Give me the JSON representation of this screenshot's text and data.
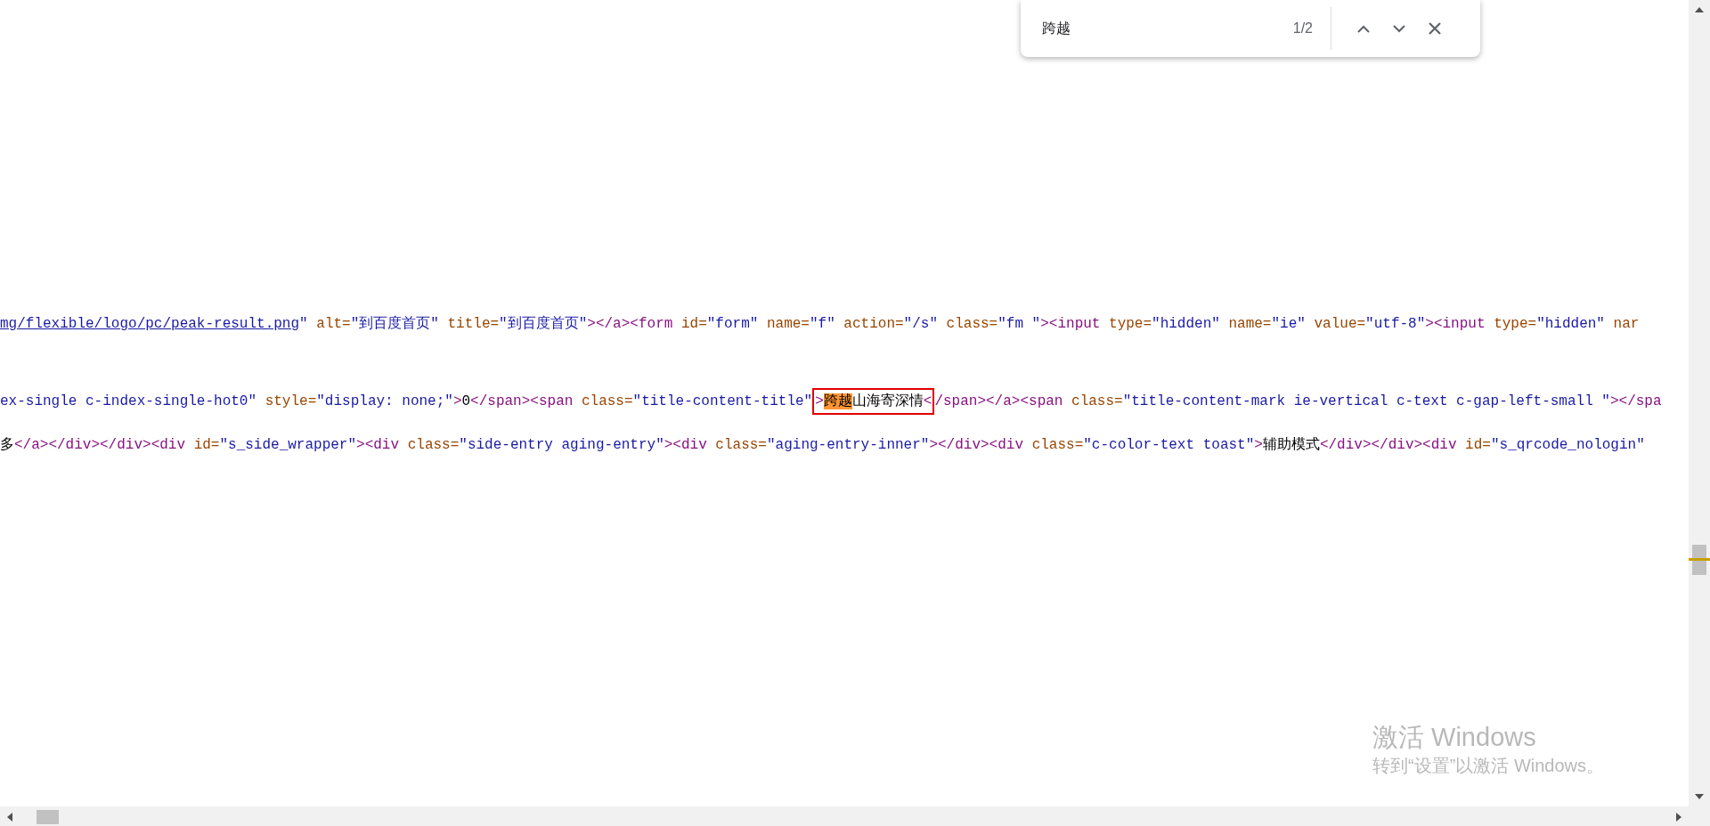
{
  "code_lines": [
    {
      "tokens": [
        {
          "kind": "link",
          "text": "mg/flexible/logo/pc/peak-result.png"
        },
        {
          "kind": "value",
          "text": "\""
        },
        {
          "kind": "attr",
          "text": " alt="
        },
        {
          "kind": "value",
          "text": "\"到百度首页\""
        },
        {
          "kind": "attr",
          "text": " title="
        },
        {
          "kind": "value",
          "text": "\"到百度首页\""
        },
        {
          "kind": "tag",
          "text": "></a><form"
        },
        {
          "kind": "attr",
          "text": " id="
        },
        {
          "kind": "value",
          "text": "\"form\""
        },
        {
          "kind": "attr",
          "text": " name="
        },
        {
          "kind": "value",
          "text": "\"f\""
        },
        {
          "kind": "attr",
          "text": " action="
        },
        {
          "kind": "value",
          "text": "\"/s\""
        },
        {
          "kind": "attr",
          "text": " class="
        },
        {
          "kind": "value",
          "text": "\"fm \""
        },
        {
          "kind": "tag",
          "text": "><input"
        },
        {
          "kind": "attr",
          "text": " type="
        },
        {
          "kind": "value",
          "text": "\"hidden\""
        },
        {
          "kind": "attr",
          "text": " name="
        },
        {
          "kind": "value",
          "text": "\"ie\""
        },
        {
          "kind": "attr",
          "text": " value="
        },
        {
          "kind": "value",
          "text": "\"utf-8\""
        },
        {
          "kind": "tag",
          "text": "><input"
        },
        {
          "kind": "attr",
          "text": " type="
        },
        {
          "kind": "value",
          "text": "\"hidden\""
        },
        {
          "kind": "attr",
          "text": " nar"
        }
      ]
    },
    {
      "tokens": [
        {
          "kind": "value",
          "text": "ex-single c-index-single-hot0\""
        },
        {
          "kind": "attr",
          "text": " style="
        },
        {
          "kind": "value",
          "text": "\"display: none;\""
        },
        {
          "kind": "tag",
          "text": ">"
        },
        {
          "kind": "text",
          "text": "0"
        },
        {
          "kind": "tag",
          "text": "</span><span"
        },
        {
          "kind": "attr",
          "text": " class="
        },
        {
          "kind": "value",
          "text": "\"title-content-title\""
        },
        {
          "kind": "tag",
          "text": ">",
          "boxed": true
        },
        {
          "kind": "match",
          "text": "跨越",
          "boxed": true
        },
        {
          "kind": "text",
          "text": "山海寄深情",
          "boxed": true
        },
        {
          "kind": "tag",
          "text": "<",
          "boxed": true
        },
        {
          "kind": "tag",
          "text": "/span></a><span"
        },
        {
          "kind": "attr",
          "text": " class="
        },
        {
          "kind": "value",
          "text": "\"title-content-mark ie-vertical c-text c-gap-left-small \""
        },
        {
          "kind": "tag",
          "text": "></spa"
        }
      ]
    },
    {
      "tokens": [
        {
          "kind": "text",
          "text": "多"
        },
        {
          "kind": "tag",
          "text": "</a></div></div><div"
        },
        {
          "kind": "attr",
          "text": " id="
        },
        {
          "kind": "value",
          "text": "\"s_side_wrapper\""
        },
        {
          "kind": "tag",
          "text": "><div"
        },
        {
          "kind": "attr",
          "text": " class="
        },
        {
          "kind": "value",
          "text": "\"side-entry aging-entry\""
        },
        {
          "kind": "tag",
          "text": "><div"
        },
        {
          "kind": "attr",
          "text": " class="
        },
        {
          "kind": "value",
          "text": "\"aging-entry-inner\""
        },
        {
          "kind": "tag",
          "text": "></div><div"
        },
        {
          "kind": "attr",
          "text": " class="
        },
        {
          "kind": "value",
          "text": "\"c-color-text toast\""
        },
        {
          "kind": "tag",
          "text": ">"
        },
        {
          "kind": "text",
          "text": "辅助模式"
        },
        {
          "kind": "tag",
          "text": "</div></div><div"
        },
        {
          "kind": "attr",
          "text": " id="
        },
        {
          "kind": "value",
          "text": "\"s_qrcode_nologin\""
        }
      ]
    }
  ],
  "find_bar": {
    "query": "跨越",
    "count": "1/2"
  },
  "activation_notice": {
    "title": "激活 Windows",
    "message": "转到“设置”以激活 Windows。"
  }
}
